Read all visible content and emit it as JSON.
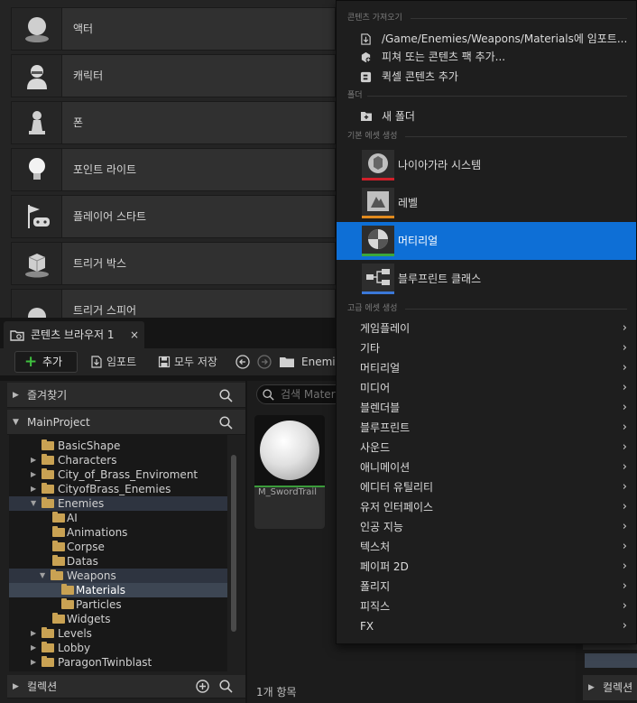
{
  "actors": {
    "items": [
      {
        "label": "액터"
      },
      {
        "label": "캐릭터"
      },
      {
        "label": "폰"
      },
      {
        "label": "포인트 라이트"
      },
      {
        "label": "플레이어 스타트"
      },
      {
        "label": "트리거 박스"
      },
      {
        "label": "트리거 스피어"
      }
    ]
  },
  "content_browser": {
    "tab_label": "콘텐츠 브라우저 1",
    "tab_close": "×",
    "toolbar": {
      "add_label": "추가",
      "add_symbol": "+",
      "import_label": "임포트",
      "save_all_label": "모두 저장",
      "path_label": "Enemie"
    },
    "favorites_label": "즐겨찾기",
    "project_label": "MainProject",
    "collections_label": "컬렉션",
    "search_placeholder": "검색 Mater",
    "tree": [
      {
        "label": "BasicShape"
      },
      {
        "label": "Characters"
      },
      {
        "label": "City_of_Brass_Enviroment"
      },
      {
        "label": "CityofBrass_Enemies"
      },
      {
        "label": "Enemies"
      },
      {
        "label": "AI"
      },
      {
        "label": "Animations"
      },
      {
        "label": "Corpse"
      },
      {
        "label": "Datas"
      },
      {
        "label": "Weapons"
      },
      {
        "label": "Materials"
      },
      {
        "label": "Particles"
      },
      {
        "label": "Widgets"
      },
      {
        "label": "Levels"
      },
      {
        "label": "Lobby"
      },
      {
        "label": "ParagonTwinblast"
      }
    ],
    "asset": {
      "name": "M_SwordTrail"
    },
    "item_count": "1개 항목"
  },
  "right_panel": {
    "collections_label": "컬렉션"
  },
  "context_menu": {
    "sections": {
      "import": "콘텐츠 가져오기",
      "folder": "폴더",
      "basic": "기본 에셋 생성",
      "advanced": "고급 에셋 생성"
    },
    "import_items": [
      {
        "label": "/Game/Enemies/Weapons/Materials에 임포트..."
      },
      {
        "label": "피쳐 또는 콘텐츠 팩 추가..."
      },
      {
        "label": "퀵셀 콘텐츠 추가"
      }
    ],
    "new_folder": "새 폴더",
    "basic_assets": [
      {
        "label": "나이아가라 시스템",
        "color": "#d0202a"
      },
      {
        "label": "레벨",
        "color": "#e08a1e"
      },
      {
        "label": "머티리얼",
        "color": "#3ca73c"
      },
      {
        "label": "블루프린트 클래스",
        "color": "#3b78d8"
      }
    ],
    "advanced_items": [
      {
        "label": "게임플레이"
      },
      {
        "label": "기타"
      },
      {
        "label": "머티리얼"
      },
      {
        "label": "미디어"
      },
      {
        "label": "블렌더블"
      },
      {
        "label": "블루프린트"
      },
      {
        "label": "사운드"
      },
      {
        "label": "애니메이션"
      },
      {
        "label": "에디터 유틸리티"
      },
      {
        "label": "유저 인터페이스"
      },
      {
        "label": "인공 지능"
      },
      {
        "label": "텍스처"
      },
      {
        "label": "페이퍼 2D"
      },
      {
        "label": "폴리지"
      },
      {
        "label": "피직스"
      },
      {
        "label": "FX"
      }
    ],
    "chevron": "›",
    "highlight_color": "#0e6fd6"
  }
}
